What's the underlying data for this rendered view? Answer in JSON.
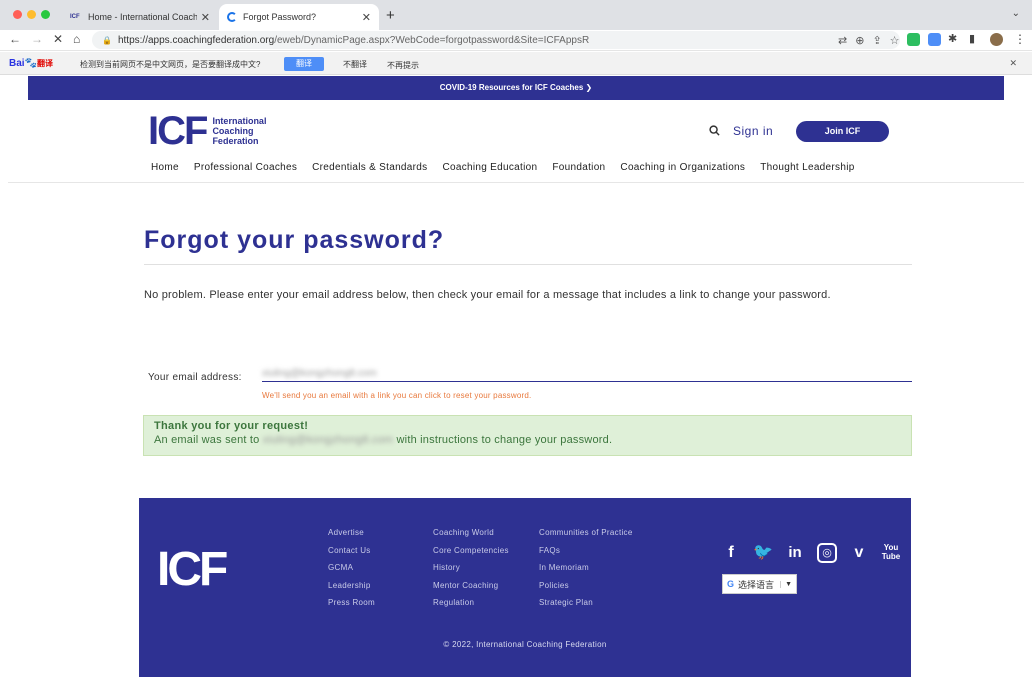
{
  "browser": {
    "tabs": [
      {
        "favicon": "ICF",
        "title": "Home - International Coaching",
        "active": false
      },
      {
        "favicon": "loading-spinner",
        "title": "Forgot Password?",
        "active": true
      }
    ],
    "url_host": "https://apps.coachingfederation.org",
    "url_path": "/eweb/DynamicPage.aspx?WebCode=forgotpassword&Site=ICFAppsR"
  },
  "translate_bar": {
    "brand": "Bai",
    "brand_suffix": "翻译",
    "message": "检测到当前网页不是中文网页，是否要翻译成中文?",
    "translate_btn": "翻译",
    "no_translate": "不翻译",
    "never": "不再提示"
  },
  "banner": {
    "text": "COVID-19 Resources for ICF Coaches ❯"
  },
  "header": {
    "logo_mark": "ICF",
    "logo_line1": "International",
    "logo_line2": "Coaching",
    "logo_line3": "Federation",
    "sign_in": "Sign in",
    "join": "Join ICF"
  },
  "nav": [
    "Home",
    "Professional Coaches",
    "Credentials & Standards",
    "Coaching Education",
    "Foundation",
    "Coaching in Organizations",
    "Thought Leadership"
  ],
  "main": {
    "title": "Forgot your password?",
    "intro": "No problem. Please enter your email address below, then check your email for a message that includes a link to change your password.",
    "email_label": "Your email address:",
    "email_value": "xiuling@kongzhong8.com",
    "hint": "We'll send you an email with a link you can click to reset your password.",
    "success_title": "Thank you for your request!",
    "success_prefix": "An email was sent to ",
    "success_email": "xiuling@kongzhong8.com",
    "success_suffix": " with instructions to change your password."
  },
  "footer": {
    "logo": "ICF",
    "col1": [
      "Advertise",
      "Contact Us",
      "GCMA",
      "Leadership",
      "Press Room"
    ],
    "col2": [
      "Coaching World",
      "Core Competencies",
      "History",
      "Mentor Coaching",
      "Regulation"
    ],
    "col3": [
      "Communities of Practice",
      "FAQs",
      "In Memoriam",
      "Policies",
      "Strategic Plan"
    ],
    "socials": [
      "facebook-icon",
      "twitter-icon",
      "linkedin-icon",
      "instagram-icon",
      "vimeo-icon",
      "youtube-icon"
    ],
    "language": "选择语言",
    "copyright": "© 2022, International Coaching Federation"
  },
  "colors": {
    "brand": "#2e3192",
    "accent": "#f5c400",
    "hint": "#e8793d",
    "success_bg": "#dff0d8"
  }
}
